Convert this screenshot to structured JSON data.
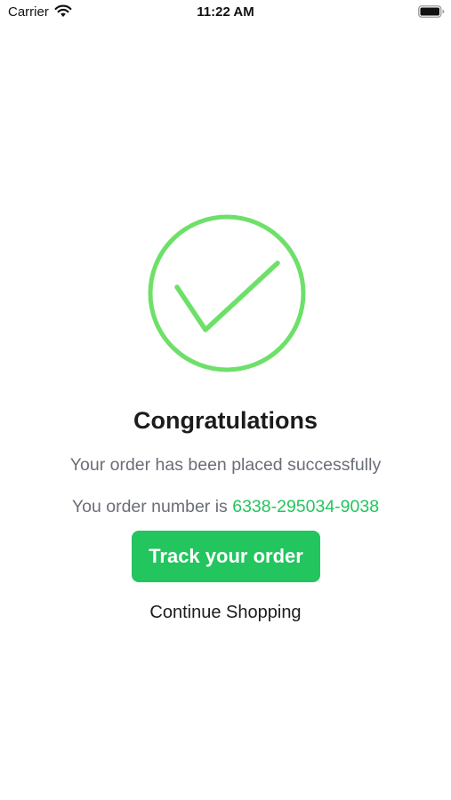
{
  "status_bar": {
    "carrier": "Carrier",
    "time": "11:22 AM",
    "wifi_icon": "wifi-icon",
    "battery_icon": "battery-icon"
  },
  "success": {
    "icon": "checkmark-circle-icon",
    "icon_color": "#6ee06a",
    "headline": "Congratulations",
    "message": "Your order has been placed successfully",
    "order_prefix": "You order number is",
    "order_number": "6338-295034-9038",
    "order_number_color": "#22c55e"
  },
  "actions": {
    "track_label": "Track your order",
    "track_color": "#22c55e",
    "continue_label": "Continue Shopping"
  }
}
